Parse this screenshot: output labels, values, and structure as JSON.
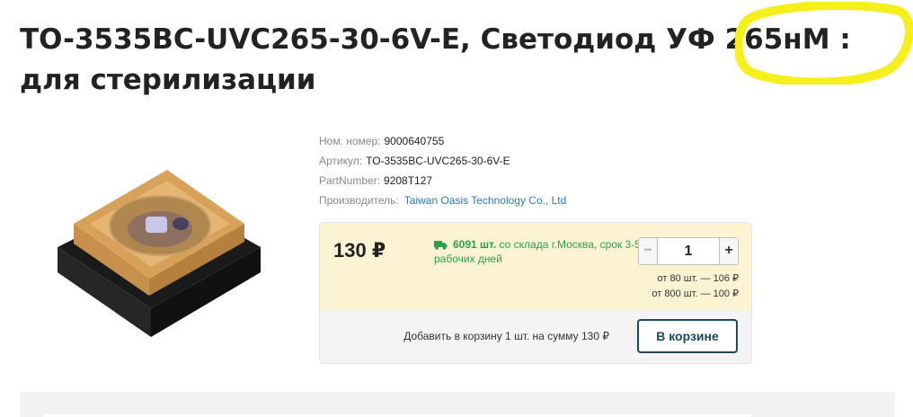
{
  "product": {
    "title_line1": "TO-3535BC-UVC265-30-6V-E, Светодиод УФ 265нМ",
    "title_line2": "для стерилизации",
    "title_cut": ":"
  },
  "meta": {
    "nom_label": "Ном. номер:",
    "nom_value": "9000640755",
    "art_label": "Артикул:",
    "art_value": "TO-3535BC-UVC265-30-6V-E",
    "pn_label": "PartNumber:",
    "pn_value": "9208T127",
    "mfr_label": "Производитель:",
    "mfr_value": "Taiwan Oasis Technology Co., Ltd"
  },
  "buy": {
    "price": "130 ₽",
    "stock_count": "6091 шт.",
    "stock_text": "со склада г.Москва, срок 3-5 рабочих дней",
    "qty_minus": "−",
    "qty_value": "1",
    "qty_plus": "+",
    "tier1": "от 80 шт. — 106 ₽",
    "tier2": "от 800 шт. — 100 ₽",
    "cart_text": "Добавить в корзину 1 шт. на сумму 130 ₽",
    "cart_button": "В корзине"
  },
  "colors": {
    "highlight": "#f5ef1c",
    "stock_green": "#2aa24a",
    "buy_bg": "#fcf3d3",
    "button_border": "#1c4a5a",
    "link_blue": "#2a7ab0"
  }
}
